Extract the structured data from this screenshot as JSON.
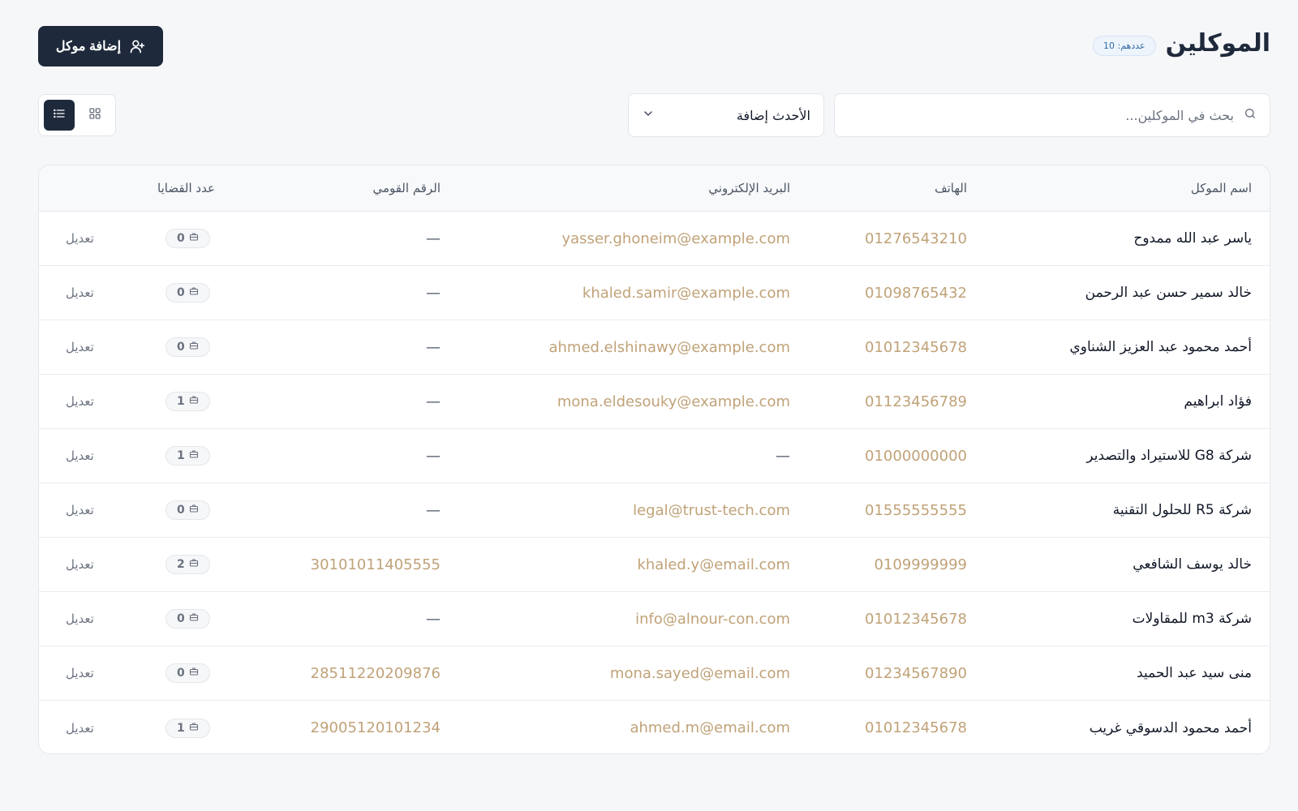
{
  "header": {
    "title": "الموكلين",
    "count_badge": "عددهم: 10",
    "add_button_label": "إضافة موكل"
  },
  "toolbar": {
    "search_placeholder": "بحث في الموكلين...",
    "sort_value": "الأحدث إضافة",
    "view_modes": [
      "list",
      "grid"
    ],
    "active_view": "list"
  },
  "table": {
    "columns": {
      "name": "اسم الموكل",
      "phone": "الهاتف",
      "email": "البريد الإلكتروني",
      "national_id": "الرقم القومي",
      "cases": "عدد القضايا"
    },
    "edit_label": "تعديل",
    "rows": [
      {
        "name": "ياسر عبد الله ممدوح",
        "phone": "01276543210",
        "email": "yasser.ghoneim@example.com",
        "national_id": "—",
        "cases": "0"
      },
      {
        "name": "خالد سمير حسن عبد الرحمن",
        "phone": "01098765432",
        "email": "khaled.samir@example.com",
        "national_id": "—",
        "cases": "0"
      },
      {
        "name": "أحمد محمود عبد العزيز الشناوي",
        "phone": "01012345678",
        "email": "ahmed.elshinawy@example.com",
        "national_id": "—",
        "cases": "0"
      },
      {
        "name": "فؤاد ابراهيم",
        "phone": "01123456789",
        "email": "mona.eldesouky@example.com",
        "national_id": "—",
        "cases": "1"
      },
      {
        "name": "شركة G8 للاستيراد والتصدير",
        "phone": "01000000000",
        "email": "—",
        "national_id": "—",
        "cases": "1"
      },
      {
        "name": "شركة R5 للحلول التقنية",
        "phone": "01555555555",
        "email": "legal@trust-tech.com",
        "national_id": "—",
        "cases": "0"
      },
      {
        "name": "خالد يوسف الشافعي",
        "phone": "0109999999",
        "email": "khaled.y@email.com",
        "national_id": "30101011405555",
        "cases": "2"
      },
      {
        "name": "شركة m3 للمقاولات",
        "phone": "01012345678",
        "email": "info@alnour-con.com",
        "national_id": "—",
        "cases": "0"
      },
      {
        "name": "منى سيد عبد الحميد",
        "phone": "01234567890",
        "email": "mona.sayed@email.com",
        "national_id": "28511220209876",
        "cases": "0"
      },
      {
        "name": "أحمد محمود الدسوقي غريب",
        "phone": "01012345678",
        "email": "ahmed.m@email.com",
        "national_id": "29005120101234",
        "cases": "1"
      }
    ]
  },
  "colors": {
    "primary": "#1e293b",
    "link_gold": "#c0a278",
    "badge_blue": "#2f6aa6"
  },
  "icons": {
    "add_button": "user-plus-icon",
    "search": "search-icon",
    "sort": "chevron-down-icon",
    "list_view": "list-icon",
    "grid_view": "grid-icon",
    "cases": "briefcase-icon"
  }
}
